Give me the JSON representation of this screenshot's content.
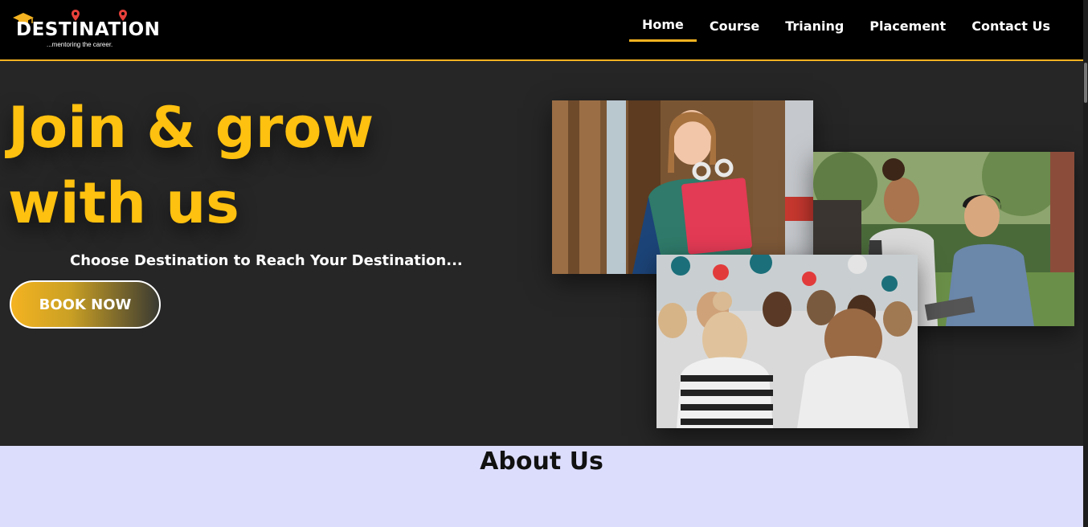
{
  "brand": {
    "name": "DESTINATION",
    "tagline": "...mentoring the career."
  },
  "nav": {
    "items": [
      {
        "label": "Home",
        "active": true
      },
      {
        "label": "Course",
        "active": false
      },
      {
        "label": "Trianing",
        "active": false
      },
      {
        "label": "Placement",
        "active": false
      },
      {
        "label": "Contact Us",
        "active": false
      }
    ]
  },
  "hero": {
    "title_line1": "Join & grow",
    "title_line2": "with us",
    "subtitle": "Choose Destination to Reach Your Destination...",
    "cta_label": "BOOK NOW"
  },
  "images": [
    {
      "icon": "student-with-books-photo"
    },
    {
      "icon": "students-talking-photo"
    },
    {
      "icon": "classroom-audience-photo"
    }
  ],
  "about": {
    "title": "About Us"
  },
  "colors": {
    "accent": "#fec10f",
    "header_bg": "#000000",
    "hero_bg": "#262626",
    "about_bg": "#dcdcfd"
  }
}
